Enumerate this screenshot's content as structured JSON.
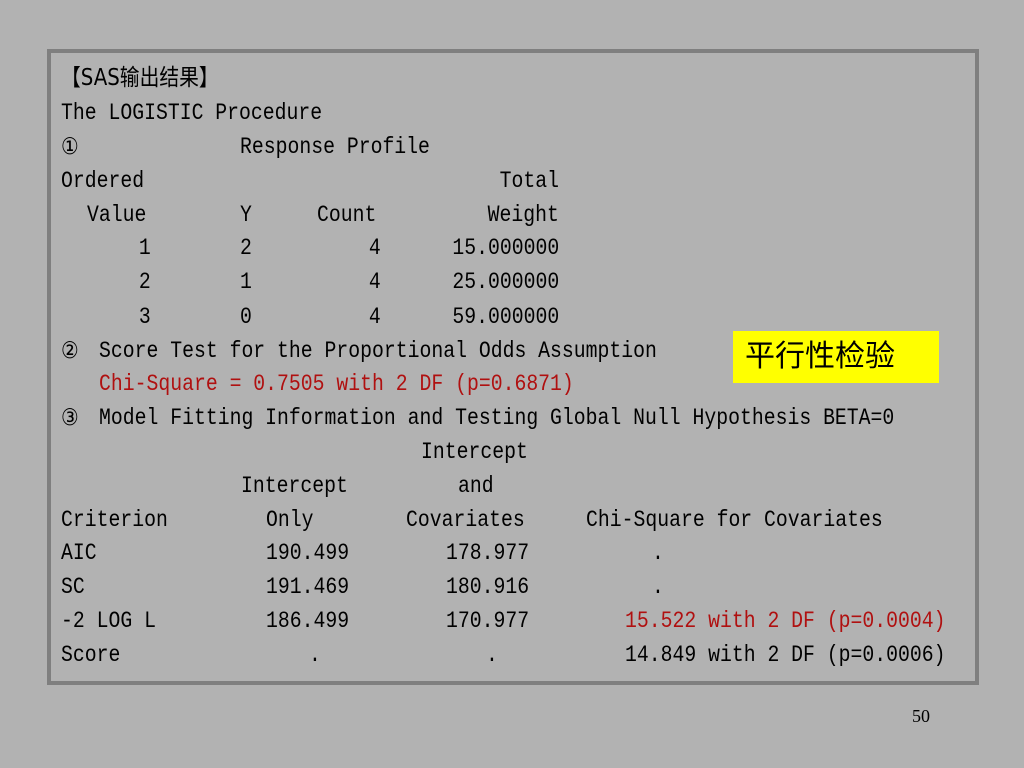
{
  "title": "【SAS输出结果】",
  "procedure": "The LOGISTIC Procedure",
  "section1": {
    "num": "①",
    "heading": "Response Profile"
  },
  "profile": {
    "hdr_ordered": "Ordered",
    "hdr_total": "Total",
    "hdr_value": "Value",
    "hdr_y": "Y",
    "hdr_count": "Count",
    "hdr_weight": "Weight",
    "rows": [
      {
        "value": "1",
        "y": "2",
        "count": "4",
        "weight": "15.000000"
      },
      {
        "value": "2",
        "y": "1",
        "count": "4",
        "weight": "25.000000"
      },
      {
        "value": "3",
        "y": "0",
        "count": "4",
        "weight": "59.000000"
      }
    ]
  },
  "section2": {
    "num": "②",
    "heading": "Score Test for the Proportional Odds Assumption"
  },
  "chisq_line": "Chi-Square = 0.7505 with 2 DF (p=0.6871)",
  "badge": "平行性检验",
  "section3": {
    "num": "③",
    "heading": "Model Fitting Information and Testing Global Null Hypothesis BETA=0"
  },
  "fit": {
    "hdr_intercept_top": "Intercept",
    "hdr_intercept": "Intercept",
    "hdr_and": "and",
    "hdr_criterion": "Criterion",
    "hdr_only": "Only",
    "hdr_covariates": "Covariates",
    "hdr_chisq": "Chi-Square for Covariates",
    "rows": [
      {
        "criterion": "AIC",
        "only": "190.499",
        "cov": "178.977",
        "chisq": "."
      },
      {
        "criterion": "SC",
        "only": "191.469",
        "cov": "180.916",
        "chisq": "."
      },
      {
        "criterion": "-2 LOG L",
        "only": "186.499",
        "cov": "170.977",
        "chisq": "15.522 with 2 DF (p=0.0004)"
      },
      {
        "criterion": "Score",
        "only": ".",
        "cov": ".",
        "chisq": "14.849 with 2 DF (p=0.0006)"
      }
    ]
  },
  "page_number": "50",
  "colors": {
    "background": "#b2b2b2",
    "border": "#7f7f7f",
    "highlight": "#ffff00",
    "emphasis": "#b01010"
  }
}
